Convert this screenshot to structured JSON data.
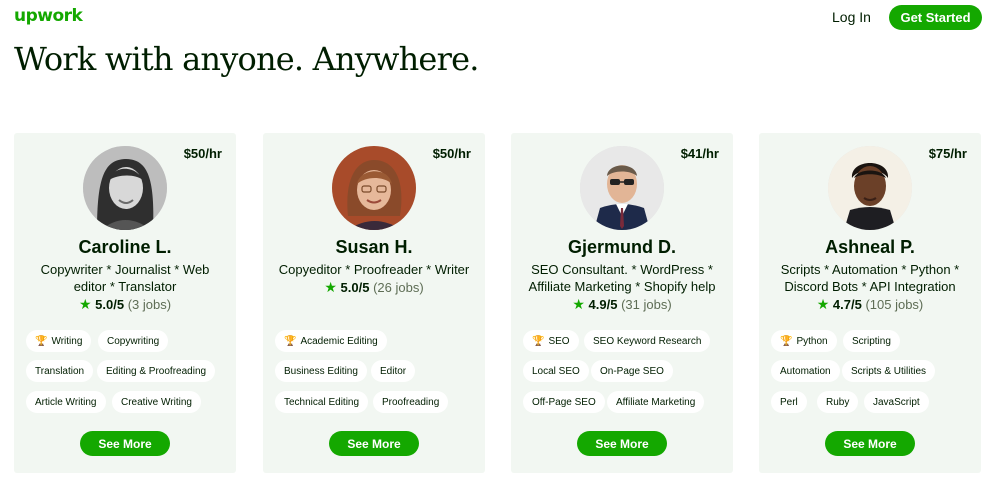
{
  "header": {
    "logo": "upwork",
    "login_label": "Log In",
    "get_started_label": "Get Started"
  },
  "headline": "Work with anyone. Anywhere.",
  "colors": {
    "brand_green": "#14a800",
    "card_bg": "#f2f7f2",
    "text": "#001e00"
  },
  "cards": [
    {
      "rate": "$50/hr",
      "name": "Caroline L.",
      "title": "Copywriter * Journalist * Web editor * Translator",
      "score": "5.0/5",
      "jobs": "(3 jobs)",
      "skills": [
        "Writing",
        "Copywriting",
        "Translation",
        "Editing & Proofreading",
        "Article Writing",
        "Creative Writing"
      ],
      "top_skill_icon": "trophy-icon",
      "see_more_label": "See More"
    },
    {
      "rate": "$50/hr",
      "name": "Susan H.",
      "title": "Copyeditor * Proofreader * Writer",
      "score": "5.0/5",
      "jobs": "(26 jobs)",
      "skills": [
        "Academic Editing",
        "Business Editing",
        "Editor",
        "Technical Editing",
        "Proofreading"
      ],
      "top_skill_icon": "trophy-icon",
      "see_more_label": "See More"
    },
    {
      "rate": "$41/hr",
      "name": "Gjermund D.",
      "title": "SEO Consultant. * WordPress * Affiliate Marketing * Shopify help",
      "score": "4.9/5",
      "jobs": "(31 jobs)",
      "skills": [
        "SEO",
        "SEO Keyword Research",
        "Local SEO",
        "On-Page SEO",
        "Off-Page SEO",
        "Affiliate Marketing"
      ],
      "top_skill_icon": "trophy-icon",
      "see_more_label": "See More"
    },
    {
      "rate": "$75/hr",
      "name": "Ashneal P.",
      "title": "Scripts * Automation * Python * Discord Bots * API Integration",
      "score": "4.7/5",
      "jobs": "(105 jobs)",
      "skills": [
        "Python",
        "Scripting",
        "Automation",
        "Scripts & Utilities",
        "Perl",
        "Ruby",
        "JavaScript"
      ],
      "top_skill_icon": "trophy-icon",
      "see_more_label": "See More"
    }
  ]
}
